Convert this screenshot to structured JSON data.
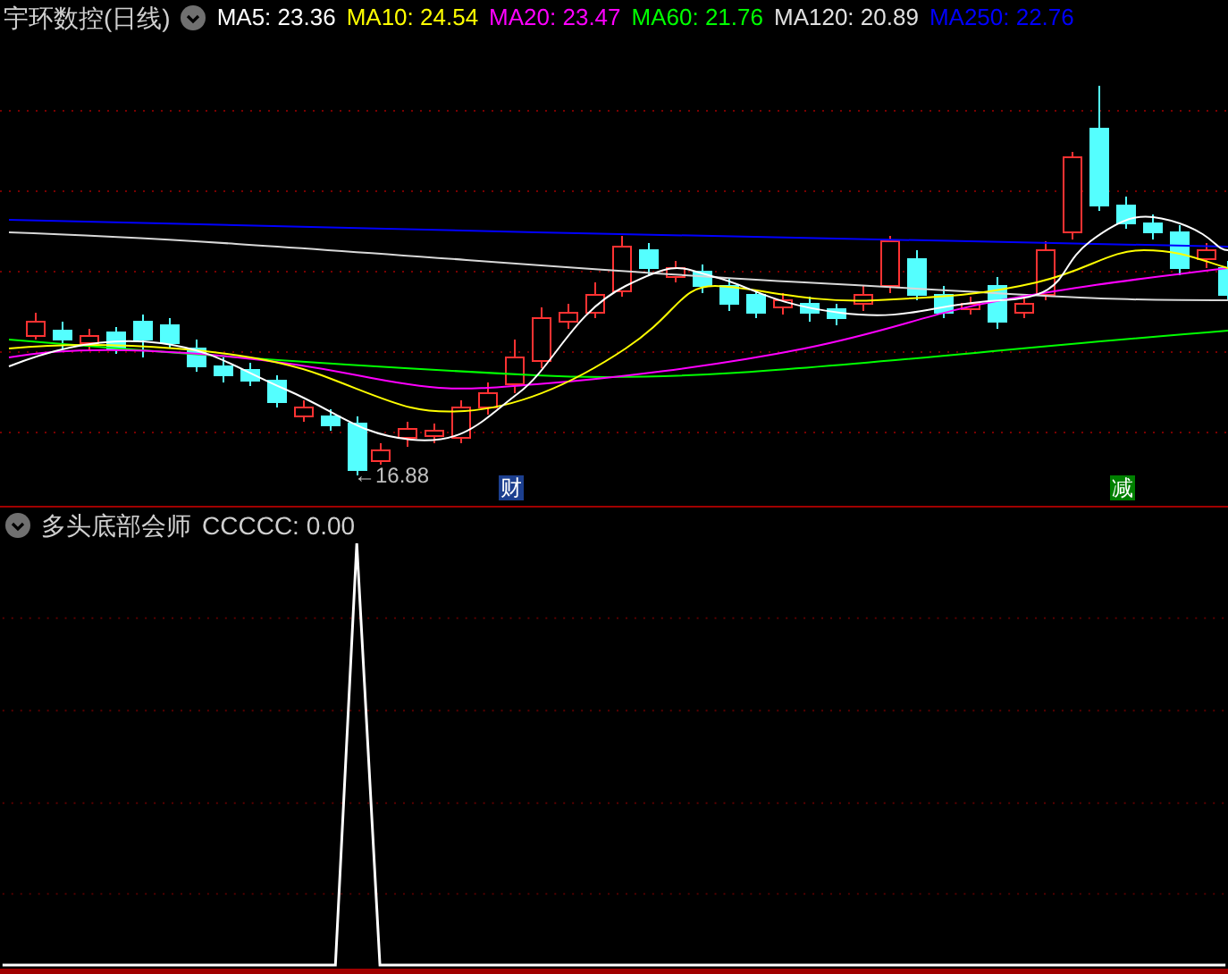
{
  "title": {
    "name": "宇环数控",
    "period": "(日线)"
  },
  "ma": [
    {
      "label": "MA5: 23.36",
      "color": "#ffffff"
    },
    {
      "label": "MA10: 24.54",
      "color": "#ffff00"
    },
    {
      "label": "MA20: 23.47",
      "color": "#ff00ff"
    },
    {
      "label": "MA60: 21.76",
      "color": "#00ff00"
    },
    {
      "label": "MA120: 20.89",
      "color": "#e0e0e0"
    },
    {
      "label": "MA250: 22.76",
      "color": "#0000ff"
    }
  ],
  "low_label": "←16.88",
  "markers": [
    {
      "text": "财",
      "color": "#1c3f8f"
    },
    {
      "text": "减",
      "color": "#008000"
    }
  ],
  "indicator": {
    "name": "多头底部会师",
    "reading": "CCCCC: 0.00"
  }
}
